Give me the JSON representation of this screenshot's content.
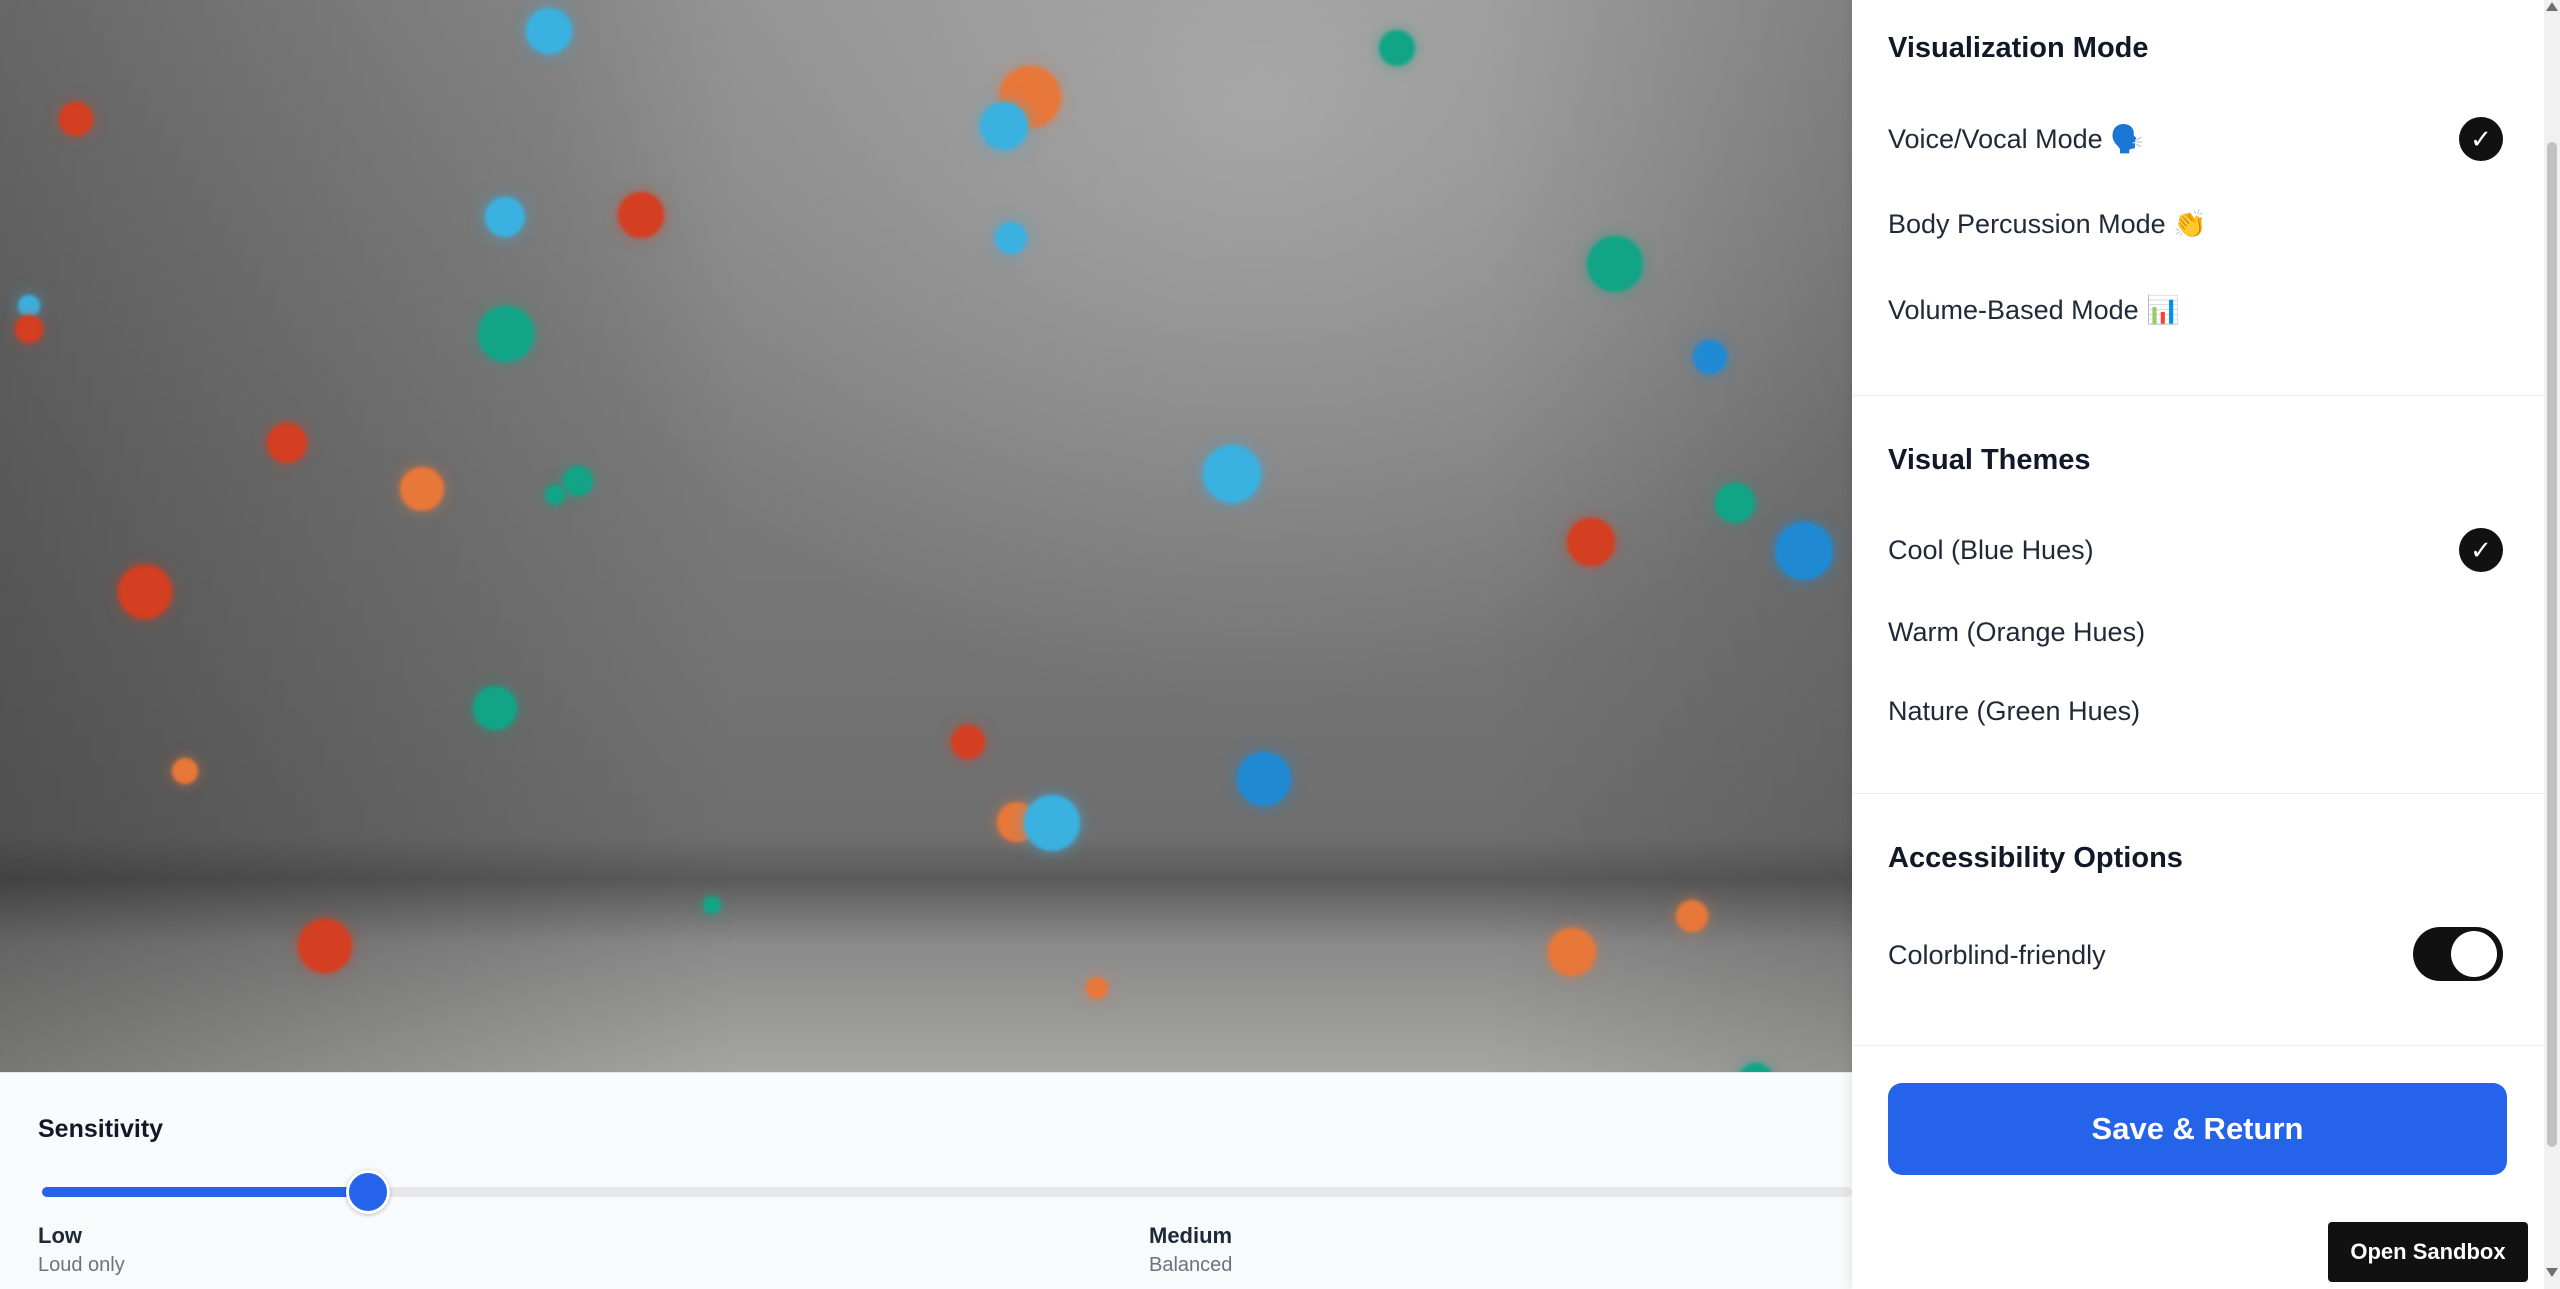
{
  "canvas": {
    "particle_colors": {
      "red": "#d43e21",
      "orange": "#e8773a",
      "light_blue": "#3ab1e0",
      "blue": "#1f8ad3",
      "teal": "#12a486"
    }
  },
  "sensitivity": {
    "title": "Sensitivity",
    "value_percent": 18,
    "stops": [
      {
        "label": "Low",
        "description": "Loud only"
      },
      {
        "label": "Medium",
        "description": "Balanced"
      }
    ]
  },
  "panel": {
    "visualization": {
      "title": "Visualization Mode",
      "options": [
        {
          "label": "Voice/Vocal Mode 🗣️",
          "selected": true
        },
        {
          "label": "Body Percussion Mode 👏",
          "selected": false
        },
        {
          "label": "Volume-Based Mode 📊",
          "selected": false
        }
      ]
    },
    "themes": {
      "title": "Visual Themes",
      "options": [
        {
          "label": "Cool (Blue Hues)",
          "selected": true
        },
        {
          "label": "Warm (Orange Hues)",
          "selected": false
        },
        {
          "label": "Nature (Green Hues)",
          "selected": false
        }
      ]
    },
    "accessibility": {
      "title": "Accessibility Options",
      "options": [
        {
          "label": "Colorblind-friendly",
          "enabled": true
        }
      ]
    },
    "check_glyph": "✓",
    "save_label": "Save & Return"
  },
  "sandbox_label": "Open Sandbox",
  "colors": {
    "accent": "#2563eb",
    "dark": "#111111"
  }
}
